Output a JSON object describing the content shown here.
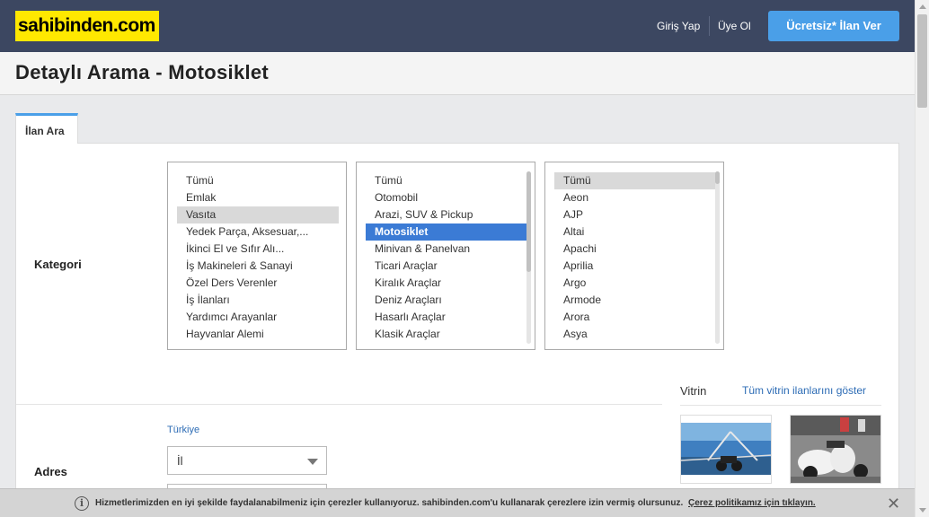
{
  "header": {
    "logo": "sahibinden.com",
    "login": "Giriş Yap",
    "register": "Üye Ol",
    "post_ad": "Ücretsiz* İlan Ver"
  },
  "page": {
    "title": "Detaylı Arama - Motosiklet"
  },
  "tabs": [
    {
      "label": "İlan Ara",
      "active": true
    }
  ],
  "category": {
    "label": "Kategori",
    "column1": {
      "items": [
        "Tümü",
        "Emlak",
        "Vasıta",
        "Yedek Parça, Aksesuar,...",
        "İkinci El ve Sıfır Alı...",
        "İş Makineleri & Sanayi",
        "Özel Ders Verenler",
        "İş İlanları",
        "Yardımcı Arayanlar",
        "Hayvanlar Alemi"
      ],
      "selected": "Vasıta"
    },
    "column2": {
      "items": [
        "Tümü",
        "Otomobil",
        "Arazi, SUV & Pickup",
        "Motosiklet",
        "Minivan & Panelvan",
        "Ticari Araçlar",
        "Kiralık Araçlar",
        "Deniz Araçları",
        "Hasarlı Araçlar",
        "Klasik Araçlar"
      ],
      "selected": "Motosiklet"
    },
    "column3": {
      "items": [
        "Tümü",
        "Aeon",
        "AJP",
        "Altai",
        "Apachi",
        "Aprilia",
        "Argo",
        "Armode",
        "Arora",
        "Asya"
      ],
      "selected": "Tümü"
    }
  },
  "address": {
    "label": "Adres",
    "country_link": "Türkiye",
    "city_select": "İl"
  },
  "vitrin": {
    "title": "Vitrin",
    "link": "Tüm vitrin ilanlarını göster"
  },
  "cookie": {
    "text": "Hizmetlerimizden en iyi şekilde faydalanabilmeniz için çerezler kullanıyoruz. sahibinden.com'u kullanarak çerezlere izin vermiş olursunuz.",
    "link": "Çerez politikamız için tıklayın.",
    "close": "✕"
  },
  "colors": {
    "header_bg": "#3c4761",
    "logo_bg": "#ffe800",
    "accent": "#4a9fe8",
    "selected_blue": "#3b7bd5"
  }
}
